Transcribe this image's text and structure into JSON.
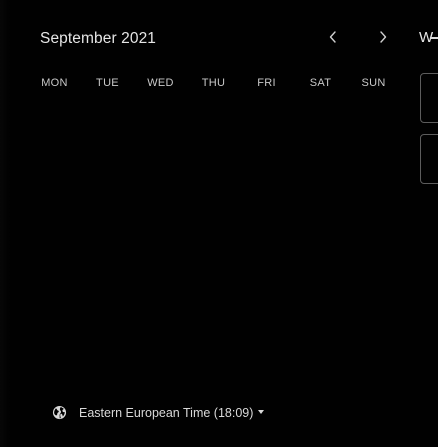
{
  "calendar": {
    "month_label": "September 2021",
    "prev_icon": "chevron-left-icon",
    "next_icon": "chevron-right-icon",
    "weekdays": [
      "MON",
      "TUE",
      "WED",
      "THU",
      "FRI",
      "SAT",
      "SUN"
    ]
  },
  "right_panel": {
    "label": "W"
  },
  "timezone": {
    "icon": "globe-icon",
    "label": "Eastern European Time (18:09)",
    "caret_icon": "caret-down-icon"
  },
  "colors": {
    "background": "#000000",
    "text": "#e6e6e6",
    "muted_text": "#c9c9c9",
    "border": "#5c5c5c"
  }
}
